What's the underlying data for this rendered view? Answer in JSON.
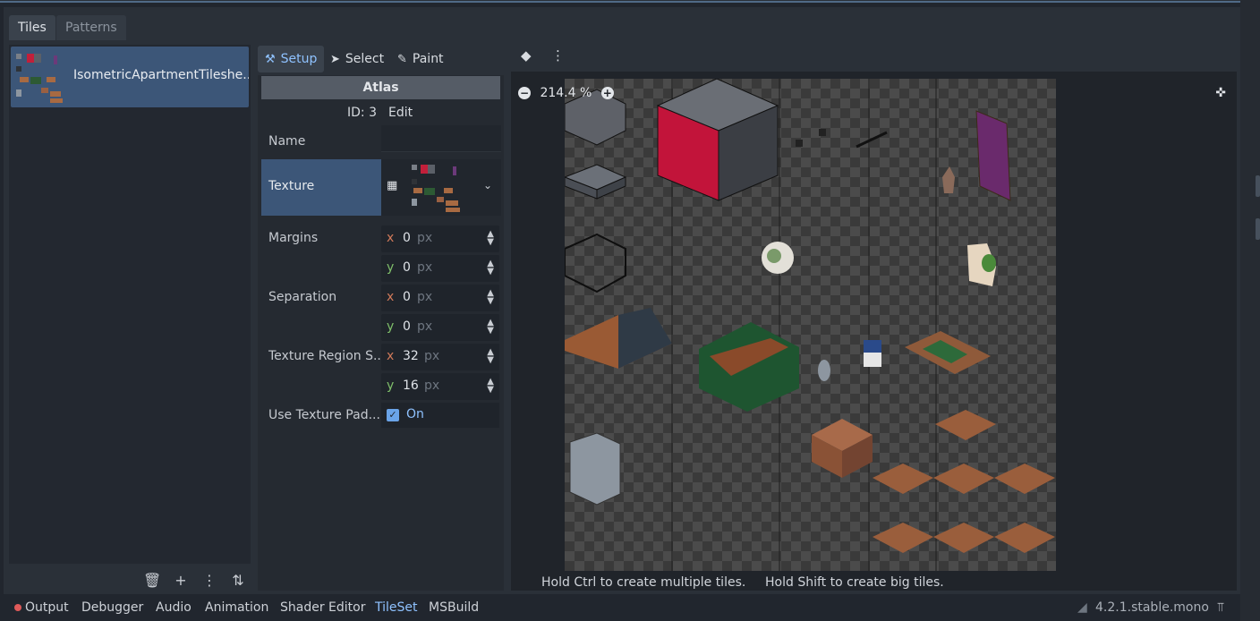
{
  "tabs": [
    {
      "label": "Tiles"
    },
    {
      "label": "Patterns"
    }
  ],
  "sources": [
    {
      "label": "IsometricApartmentTileshe..."
    }
  ],
  "modes": {
    "setup": "Setup",
    "select": "Select",
    "paint": "Paint"
  },
  "inspector": {
    "header": "Atlas",
    "id_label": "ID: 3",
    "edit_label": "Edit",
    "name_label": "Name",
    "texture_label": "Texture",
    "margins_label": "Margins",
    "margins_x": "0",
    "margins_y": "0",
    "separation_label": "Separation",
    "separation_x": "0",
    "separation_y": "0",
    "region_label": "Texture Region S...",
    "region_x": "32",
    "region_y": "16",
    "padding_label": "Use Texture Pad...",
    "padding_value": "On",
    "unit": "px",
    "axis_x": "x",
    "axis_y": "y"
  },
  "viewport": {
    "zoom": "214.4 %",
    "hint_ctrl": "Hold Ctrl to create multiple tiles.",
    "hint_shift": "Hold Shift to create big tiles."
  },
  "statusbar": {
    "items": [
      "Output",
      "Debugger",
      "Audio",
      "Animation",
      "Shader Editor",
      "TileSet",
      "MSBuild"
    ],
    "active": "TileSet",
    "version": "4.2.1.stable.mono"
  },
  "colors": {
    "accent": "#8fc2ff",
    "selection": "#3c5678",
    "error_dot": "#e05a5a"
  },
  "icons": [
    "trash-icon",
    "add-icon",
    "more-icon",
    "sort-icon",
    "eraser-icon",
    "zoom-out-icon",
    "zoom-in-icon",
    "center-view-icon",
    "texture-icon",
    "dropdown-icon",
    "checkbox-icon"
  ]
}
